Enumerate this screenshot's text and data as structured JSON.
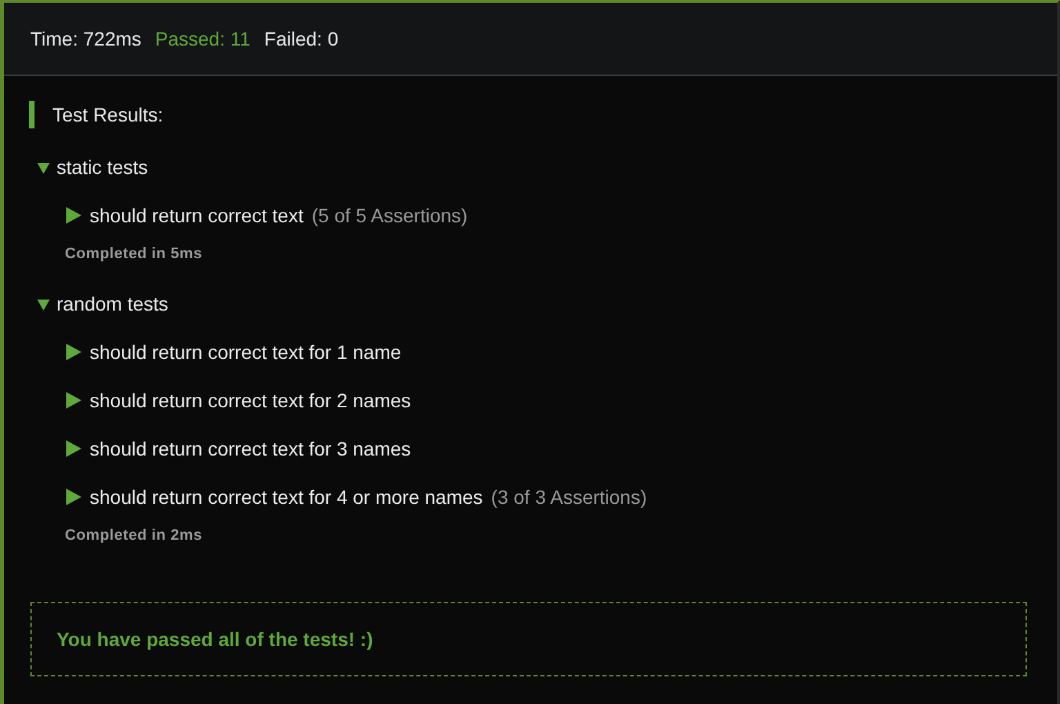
{
  "summary": {
    "time": "Time: 722ms",
    "passed": "Passed: 11",
    "failed": "Failed: 0"
  },
  "heading": "Test Results:",
  "groups": [
    {
      "title": "static tests",
      "expanded": true,
      "tests": [
        {
          "title": "should return correct text",
          "assertions": "(5 of 5 Assertions)",
          "expanded": false
        }
      ],
      "completed": "Completed in 5ms"
    },
    {
      "title": "random tests",
      "expanded": true,
      "tests": [
        {
          "title": "should return correct text for 1 name",
          "expanded": false
        },
        {
          "title": "should return correct text for 2 names",
          "expanded": false
        },
        {
          "title": "should return correct text for 3 names",
          "expanded": false
        },
        {
          "title": "should return correct text for 4 or more names",
          "assertions": "(3 of 3 Assertions)",
          "expanded": false
        }
      ],
      "completed": "Completed in 2ms"
    }
  ],
  "message": "You have passed all of the tests! :)"
}
